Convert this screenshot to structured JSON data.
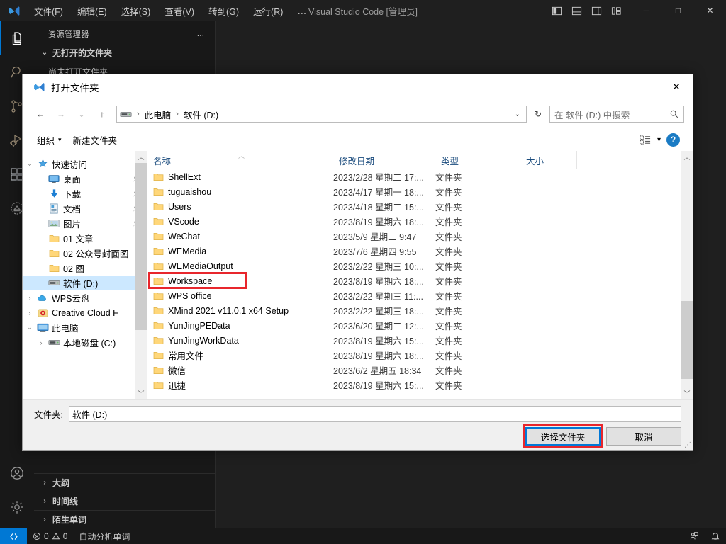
{
  "vscode": {
    "menus": [
      "文件(F)",
      "编辑(E)",
      "选择(S)",
      "查看(V)",
      "转到(G)",
      "运行(R)"
    ],
    "menu_overflow": "…",
    "window_title": "Visual Studio Code [管理员]",
    "layout_icons": [
      "toggle-primary-sidebar-icon",
      "toggle-panel-icon",
      "toggle-secondary-sidebar-icon",
      "customize-layout-icon"
    ],
    "window_controls": {
      "minimize": "─",
      "maximize": "□",
      "close": "✕"
    },
    "activitybar": [
      {
        "name": "explorer",
        "icon": "files-icon",
        "active": true
      },
      {
        "name": "search",
        "icon": "search-icon",
        "active": false
      },
      {
        "name": "source-control",
        "icon": "source-control-icon",
        "active": false
      },
      {
        "name": "run-and-debug",
        "icon": "run-debug-icon",
        "active": false
      },
      {
        "name": "extensions",
        "icon": "extensions-icon",
        "active": false
      },
      {
        "name": "custom-view",
        "icon": "circle-badge-icon",
        "active": false
      }
    ],
    "activitybar_bottom": [
      {
        "name": "accounts",
        "icon": "account-icon"
      },
      {
        "name": "manage",
        "icon": "gear-icon"
      }
    ],
    "sidebar": {
      "title": "资源管理器",
      "more_actions": "…",
      "sections": [
        {
          "label": "无打开的文件夹",
          "expanded": true
        },
        {
          "label": "大纲",
          "expanded": false
        },
        {
          "label": "时间线",
          "expanded": false
        },
        {
          "label": "陌生单词",
          "expanded": false
        }
      ],
      "hint_line": "尚未打开文件夹"
    },
    "statusbar": {
      "remote_icon": "remote-window-icon",
      "errors": "0",
      "warnings": "0",
      "task": "自动分析单词",
      "right_icons": [
        "feedback-icon",
        "bell-icon"
      ]
    }
  },
  "dialog": {
    "title": "打开文件夹",
    "title_icon": "vscode-icon",
    "close_label": "✕",
    "nav": {
      "back": "←",
      "forward": "→",
      "recent": "⌄",
      "up": "↑"
    },
    "address": {
      "drive_icon": "drive-icon",
      "crumbs": [
        "此电脑",
        "软件 (D:)"
      ],
      "separator": "›",
      "dropdown": "⌄"
    },
    "refresh": "↻",
    "search": {
      "placeholder": "在 软件 (D:) 中搜索",
      "value": "",
      "icon": "search-icon"
    },
    "toolbar": {
      "organize": "组织",
      "organize_caret": "▾",
      "new_folder": "新建文件夹",
      "view_icon": "view-layout-icon",
      "view_caret": "▾",
      "help": "?"
    },
    "tree": [
      {
        "label": "快速访问",
        "icon": "pin-star-icon",
        "indent": 0,
        "expander": "⌄",
        "pinned": false,
        "selected": false
      },
      {
        "label": "桌面",
        "icon": "desktop-icon",
        "indent": 1,
        "expander": "",
        "pinned": true,
        "selected": false
      },
      {
        "label": "下载",
        "icon": "download-icon",
        "indent": 1,
        "expander": "",
        "pinned": true,
        "selected": false
      },
      {
        "label": "文档",
        "icon": "documents-icon",
        "indent": 1,
        "expander": "",
        "pinned": true,
        "selected": false
      },
      {
        "label": "图片",
        "icon": "pictures-icon",
        "indent": 1,
        "expander": "",
        "pinned": true,
        "selected": false
      },
      {
        "label": "01 文章",
        "icon": "folder-icon",
        "indent": 1,
        "expander": "",
        "pinned": false,
        "selected": false
      },
      {
        "label": "02 公众号封面图",
        "icon": "folder-icon",
        "indent": 1,
        "expander": "",
        "pinned": false,
        "selected": false
      },
      {
        "label": "02 图",
        "icon": "folder-icon",
        "indent": 1,
        "expander": "",
        "pinned": false,
        "selected": false
      },
      {
        "label": "软件 (D:)",
        "icon": "drive-icon",
        "indent": 1,
        "expander": "",
        "pinned": false,
        "selected": true
      },
      {
        "label": "WPS云盘",
        "icon": "cloud-icon",
        "indent": 0,
        "expander": "›",
        "pinned": false,
        "selected": false
      },
      {
        "label": "Creative Cloud F",
        "icon": "creative-cloud-icon",
        "indent": 0,
        "expander": "›",
        "pinned": false,
        "selected": false
      },
      {
        "label": "此电脑",
        "icon": "this-pc-icon",
        "indent": 0,
        "expander": "⌄",
        "pinned": false,
        "selected": false
      },
      {
        "label": "本地磁盘 (C:)",
        "icon": "drive-icon",
        "indent": 1,
        "expander": "›",
        "pinned": false,
        "selected": false
      }
    ],
    "columns": [
      "名称",
      "修改日期",
      "类型",
      "大小"
    ],
    "files": [
      {
        "name": "ShellExt",
        "date": "2023/2/28 星期二 17:...",
        "type": "文件夹",
        "size": "",
        "highlight": false
      },
      {
        "name": "tuguaishou",
        "date": "2023/4/17 星期一 18:...",
        "type": "文件夹",
        "size": "",
        "highlight": false
      },
      {
        "name": "Users",
        "date": "2023/4/18 星期二 15:...",
        "type": "文件夹",
        "size": "",
        "highlight": false
      },
      {
        "name": "VScode",
        "date": "2023/8/19 星期六 18:...",
        "type": "文件夹",
        "size": "",
        "highlight": false
      },
      {
        "name": "WeChat",
        "date": "2023/5/9 星期二 9:47",
        "type": "文件夹",
        "size": "",
        "highlight": false
      },
      {
        "name": "WEMedia",
        "date": "2023/7/6 星期四 9:55",
        "type": "文件夹",
        "size": "",
        "highlight": false
      },
      {
        "name": "WEMediaOutput",
        "date": "2023/2/22 星期三 10:...",
        "type": "文件夹",
        "size": "",
        "highlight": false
      },
      {
        "name": "Workspace",
        "date": "2023/8/19 星期六 18:...",
        "type": "文件夹",
        "size": "",
        "highlight": true
      },
      {
        "name": "WPS office",
        "date": "2023/2/22 星期三 11:...",
        "type": "文件夹",
        "size": "",
        "highlight": false
      },
      {
        "name": "XMind 2021 v11.0.1 x64 Setup",
        "date": "2023/2/22 星期三 18:...",
        "type": "文件夹",
        "size": "",
        "highlight": false
      },
      {
        "name": "YunJingPEData",
        "date": "2023/6/20 星期二 12:...",
        "type": "文件夹",
        "size": "",
        "highlight": false
      },
      {
        "name": "YunJingWorkData",
        "date": "2023/8/19 星期六 15:...",
        "type": "文件夹",
        "size": "",
        "highlight": false
      },
      {
        "name": "常用文件",
        "date": "2023/8/19 星期六 18:...",
        "type": "文件夹",
        "size": "",
        "highlight": false
      },
      {
        "name": "微信",
        "date": "2023/6/2 星期五 18:34",
        "type": "文件夹",
        "size": "",
        "highlight": false
      },
      {
        "name": "迅捷",
        "date": "2023/8/19 星期六 15:...",
        "type": "文件夹",
        "size": "",
        "highlight": false
      }
    ],
    "footer": {
      "folder_label": "文件夹:",
      "folder_value": "软件 (D:)",
      "select_button": "选择文件夹",
      "cancel_button": "取消"
    }
  },
  "colors": {
    "accent_blue": "#0078d4",
    "highlight_red": "#e8262c",
    "selection_blue": "#cce8ff",
    "vscode_bg": "#1e1e1e",
    "vscode_panel": "#181818"
  }
}
